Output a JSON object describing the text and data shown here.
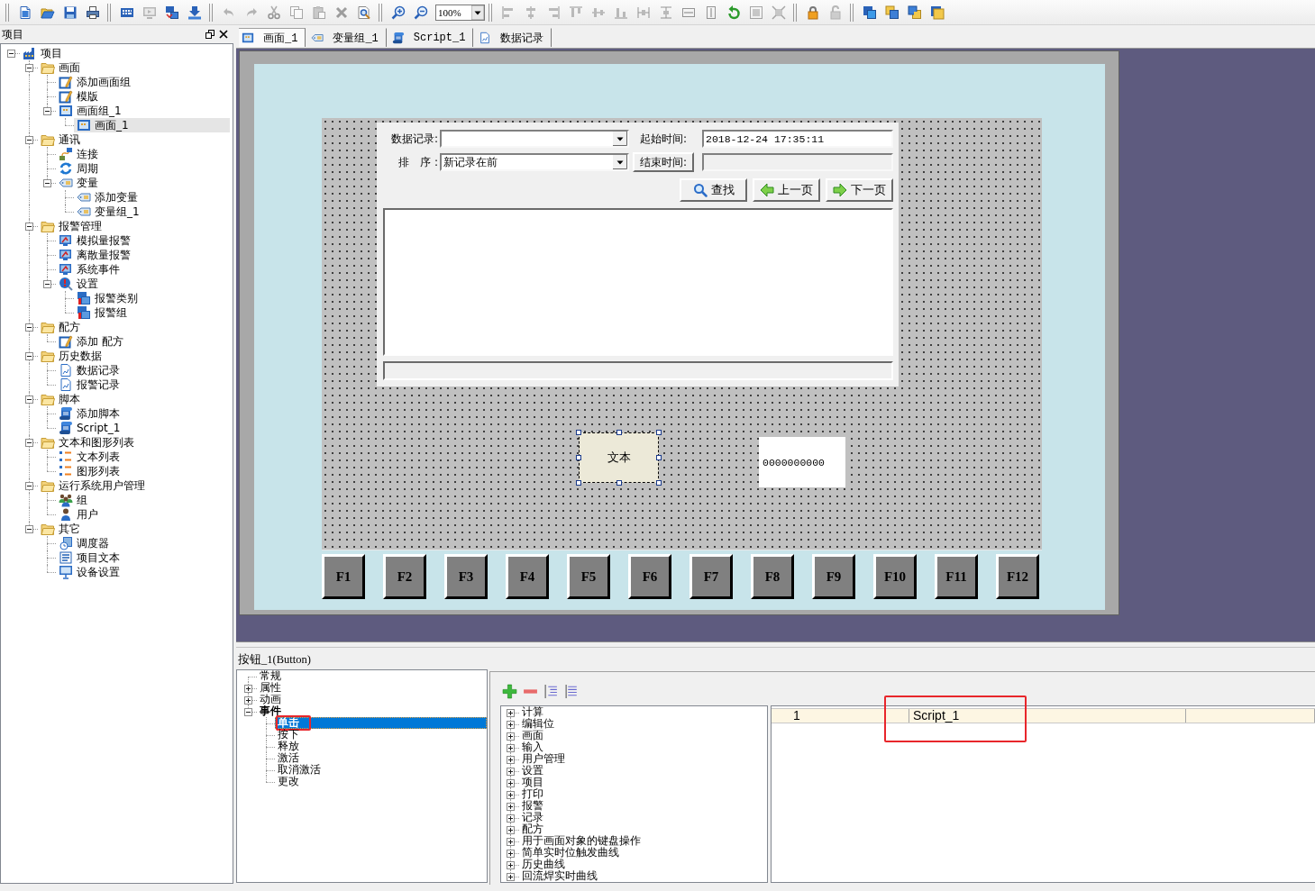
{
  "toolbar": {
    "groups": [
      {
        "buttons": [
          {
            "kind": "new",
            "disabled": false
          },
          {
            "kind": "open",
            "disabled": false
          },
          {
            "kind": "save",
            "disabled": false
          },
          {
            "kind": "print",
            "disabled": false
          }
        ]
      },
      {
        "buttons": [
          {
            "kind": "keyboard",
            "disabled": false
          },
          {
            "kind": "simulate",
            "disabled": true
          },
          {
            "kind": "transfer",
            "disabled": false
          },
          {
            "kind": "download",
            "disabled": false
          }
        ]
      },
      {
        "buttons": [
          {
            "kind": "undo",
            "disabled": true
          },
          {
            "kind": "redo",
            "disabled": true
          },
          {
            "kind": "cut",
            "disabled": true
          },
          {
            "kind": "copy",
            "disabled": true
          },
          {
            "kind": "paste",
            "disabled": true
          },
          {
            "kind": "delete",
            "disabled": true
          },
          {
            "kind": "find",
            "disabled": false
          }
        ]
      },
      {
        "buttons": [
          {
            "kind": "zoom_in",
            "disabled": false
          },
          {
            "kind": "zoom_out",
            "disabled": false
          }
        ],
        "zoom": "100%"
      },
      {
        "buttons": [
          {
            "kind": "align_left",
            "disabled": true
          },
          {
            "kind": "align_center",
            "disabled": true
          },
          {
            "kind": "align_right",
            "disabled": true
          },
          {
            "kind": "align_top",
            "disabled": true
          },
          {
            "kind": "align_middle",
            "disabled": true
          },
          {
            "kind": "align_bottom",
            "disabled": true
          },
          {
            "kind": "distribute_h",
            "disabled": true
          },
          {
            "kind": "distribute_v",
            "disabled": true
          },
          {
            "kind": "same_width",
            "disabled": true
          },
          {
            "kind": "same_height",
            "disabled": true
          },
          {
            "kind": "rotate",
            "disabled": false
          },
          {
            "kind": "fit",
            "disabled": true
          },
          {
            "kind": "resize",
            "disabled": true
          }
        ]
      },
      {
        "buttons": [
          {
            "kind": "lock",
            "disabled": false
          },
          {
            "kind": "unlock",
            "disabled": true
          }
        ]
      },
      {
        "buttons": [
          {
            "kind": "to_front",
            "disabled": false
          },
          {
            "kind": "forward",
            "disabled": false
          },
          {
            "kind": "backward",
            "disabled": false
          },
          {
            "kind": "to_back",
            "disabled": false
          }
        ]
      }
    ]
  },
  "project_panel": {
    "title": "项目",
    "tree": [
      {
        "label": "项目",
        "kind": "project",
        "expanded": true,
        "selected": false,
        "children": [
          {
            "label": "画面",
            "kind": "folder",
            "expanded": true,
            "selected": false,
            "children": [
              {
                "label": "添加画面组",
                "kind": "pencil",
                "selected": false
              },
              {
                "label": "模版",
                "kind": "pencil",
                "selected": false
              },
              {
                "label": "画面组_1",
                "kind": "screen",
                "expanded": true,
                "selected": false,
                "children": [
                  {
                    "label": "画面_1",
                    "kind": "screen",
                    "selected": true
                  }
                ]
              }
            ]
          },
          {
            "label": "通讯",
            "kind": "folder",
            "expanded": true,
            "selected": false,
            "children": [
              {
                "label": "连接",
                "kind": "link",
                "selected": false
              },
              {
                "label": "周期",
                "kind": "cycle",
                "selected": false
              },
              {
                "label": "变量",
                "kind": "tag",
                "expanded": true,
                "selected": false,
                "children": [
                  {
                    "label": "添加变量",
                    "kind": "tag",
                    "selected": false
                  },
                  {
                    "label": "变量组_1",
                    "kind": "tag",
                    "selected": false
                  }
                ]
              }
            ]
          },
          {
            "label": "报警管理",
            "kind": "folder",
            "expanded": true,
            "selected": false,
            "children": [
              {
                "label": "模拟量报警",
                "kind": "alarm",
                "selected": false
              },
              {
                "label": "离散量报警",
                "kind": "alarm",
                "selected": false
              },
              {
                "label": "系统事件",
                "kind": "alarm",
                "selected": false
              },
              {
                "label": "设置",
                "kind": "alarm_settings",
                "expanded": true,
                "selected": false,
                "children": [
                  {
                    "label": "报警类别",
                    "kind": "alarm_stack",
                    "selected": false
                  },
                  {
                    "label": "报警组",
                    "kind": "alarm_stack",
                    "selected": false
                  }
                ]
              }
            ]
          },
          {
            "label": "配方",
            "kind": "folder",
            "expanded": true,
            "selected": false,
            "children": [
              {
                "label": "添加 配方",
                "kind": "pencil",
                "selected": false
              }
            ]
          },
          {
            "label": "历史数据",
            "kind": "folder",
            "expanded": true,
            "selected": false,
            "children": [
              {
                "label": "数据记录",
                "kind": "document",
                "selected": false
              },
              {
                "label": "报警记录",
                "kind": "document",
                "selected": false
              }
            ]
          },
          {
            "label": "脚本",
            "kind": "folder",
            "expanded": true,
            "selected": false,
            "children": [
              {
                "label": "添加脚本",
                "kind": "script",
                "selected": false
              },
              {
                "label": "Script_1",
                "kind": "script",
                "selected": false
              }
            ]
          },
          {
            "label": "文本和图形列表",
            "kind": "folder",
            "expanded": true,
            "selected": false,
            "children": [
              {
                "label": "文本列表",
                "kind": "list",
                "selected": false
              },
              {
                "label": "图形列表",
                "kind": "list",
                "selected": false
              }
            ]
          },
          {
            "label": "运行系统用户管理",
            "kind": "folder",
            "expanded": true,
            "selected": false,
            "children": [
              {
                "label": "组",
                "kind": "users",
                "selected": false
              },
              {
                "label": "用户",
                "kind": "user",
                "selected": false
              }
            ]
          },
          {
            "label": "其它",
            "kind": "folder",
            "expanded": true,
            "selected": false,
            "children": [
              {
                "label": "调度器",
                "kind": "scheduler",
                "selected": false
              },
              {
                "label": "项目文本",
                "kind": "text",
                "selected": false
              },
              {
                "label": "设备设置",
                "kind": "monitor",
                "selected": false
              }
            ]
          }
        ]
      }
    ]
  },
  "tabs": [
    {
      "label": "画面_1",
      "kind": "screen",
      "selected": true
    },
    {
      "label": "变量组_1",
      "kind": "tag",
      "selected": false
    },
    {
      "label": "Script_1",
      "kind": "script",
      "selected": false
    },
    {
      "label": "数据记录",
      "kind": "document",
      "selected": false
    }
  ],
  "screen": {
    "record_view": {
      "log": {
        "label": "数据记录:"
      },
      "start_time": {
        "label": "起始时间:",
        "value": "2018-12-24 17:35:11"
      },
      "order": {
        "label": "排　序 :",
        "value": "新记录在前"
      },
      "end_time": {
        "label": "结束时间:"
      },
      "buttons": [
        {
          "kind": "search",
          "label": "查找"
        },
        {
          "kind": "previous",
          "label": "上一页"
        },
        {
          "kind": "next",
          "label": "下一页"
        }
      ]
    },
    "objects": [
      {
        "kind": "text",
        "text": "文本",
        "selected": true
      },
      {
        "kind": "io_field",
        "text": "0000000000",
        "selected": false
      }
    ],
    "function_keys": [
      "F1",
      "F2",
      "F3",
      "F4",
      "F5",
      "F6",
      "F7",
      "F8",
      "F9",
      "F10",
      "F11",
      "F12"
    ]
  },
  "properties_panel": {
    "title": "按钮_1(Button)",
    "categories": [
      {
        "label": "常规",
        "selected": false,
        "has_actions": false,
        "marked": false
      },
      {
        "label": "属性",
        "expanded": false,
        "selected": false,
        "has_actions": false,
        "marked": false
      },
      {
        "label": "动画",
        "expanded": false,
        "selected": false,
        "has_actions": false,
        "marked": false
      },
      {
        "label": "事件",
        "expanded": true,
        "selected": false,
        "has_actions": true,
        "marked": false,
        "children": [
          {
            "label": "单击",
            "selected": true,
            "has_actions": true,
            "marked": true
          },
          {
            "label": "按下",
            "selected": false,
            "has_actions": false,
            "marked": false
          },
          {
            "label": "释放",
            "selected": false,
            "has_actions": false,
            "marked": false
          },
          {
            "label": "激活",
            "selected": false,
            "has_actions": false,
            "marked": false
          },
          {
            "label": "取消激活",
            "selected": false,
            "has_actions": false,
            "marked": false
          },
          {
            "label": "更改",
            "selected": false,
            "has_actions": false,
            "marked": false
          }
        ]
      }
    ],
    "functions": [
      {
        "label": "计算",
        "expanded": false,
        "selected": false
      },
      {
        "label": "编辑位",
        "expanded": false,
        "selected": false
      },
      {
        "label": "画面",
        "expanded": false,
        "selected": false
      },
      {
        "label": "输入",
        "expanded": false,
        "selected": false
      },
      {
        "label": "用户管理",
        "expanded": false,
        "selected": false
      },
      {
        "label": "设置",
        "expanded": false,
        "selected": false
      },
      {
        "label": "项目",
        "expanded": false,
        "selected": false
      },
      {
        "label": "打印",
        "expanded": false,
        "selected": false
      },
      {
        "label": "报警",
        "expanded": false,
        "selected": false
      },
      {
        "label": "记录",
        "expanded": false,
        "selected": false
      },
      {
        "label": "配方",
        "expanded": false,
        "selected": false
      },
      {
        "label": "用于画面对象的键盘操作",
        "expanded": false,
        "selected": false
      },
      {
        "label": "简单实时位触发曲线",
        "expanded": false,
        "selected": false
      },
      {
        "label": "历史曲线",
        "expanded": false,
        "selected": false
      },
      {
        "label": "回流焊实时曲线",
        "expanded": false,
        "selected": false
      }
    ],
    "function_list": {
      "rows": [
        {
          "selected": true,
          "cells": [
            {
              "text": "1",
              "marked": false
            },
            {
              "text": "Script_1",
              "marked": true
            }
          ]
        }
      ]
    }
  }
}
